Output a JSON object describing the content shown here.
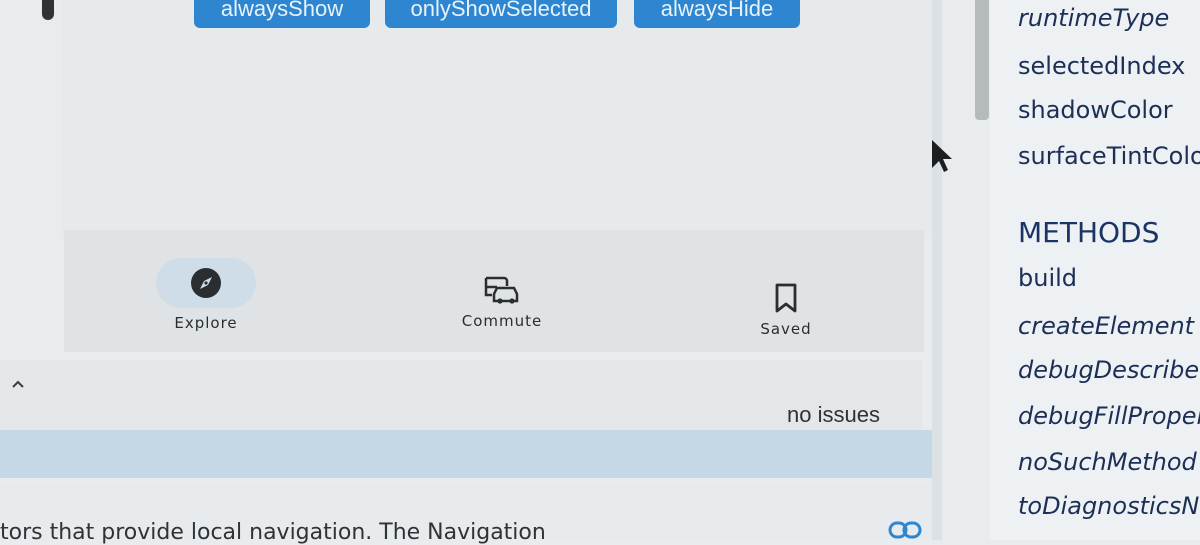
{
  "demo": {
    "buttons": [
      {
        "label": "alwaysShow"
      },
      {
        "label": "onlyShowSelected"
      },
      {
        "label": "alwaysHide"
      }
    ]
  },
  "navigation_bar": {
    "items": [
      {
        "label": "Explore",
        "icon": "explore-icon",
        "selected": true
      },
      {
        "label": "Commute",
        "icon": "commute-icon",
        "selected": false
      },
      {
        "label": "Saved",
        "icon": "bookmark-icon",
        "selected": false
      }
    ],
    "selected_indicator_color": "#cfdde8"
  },
  "status": {
    "issues_text": "no issues"
  },
  "documentation": {
    "visible_text": "tors that provide local navigation. The Navigation"
  },
  "api_sidebar": {
    "properties": [
      {
        "name": "runtimeType",
        "inherited": true
      },
      {
        "name": "selectedIndex",
        "inherited": false
      },
      {
        "name": "shadowColor",
        "inherited": false
      },
      {
        "name": "surfaceTintColo",
        "inherited": false
      }
    ],
    "methods_heading": "METHODS",
    "methods": [
      {
        "name": "build",
        "inherited": false
      },
      {
        "name": "createElement",
        "inherited": true
      },
      {
        "name": "debugDescribeC",
        "inherited": true
      },
      {
        "name": "debugFillPropert",
        "inherited": true
      },
      {
        "name": "noSuchMethod",
        "inherited": true
      },
      {
        "name": "toDiagnosticsNo",
        "inherited": true
      }
    ]
  },
  "colors": {
    "button_blue": "#2d86cf",
    "sidebar_text": "#1b2f57"
  }
}
